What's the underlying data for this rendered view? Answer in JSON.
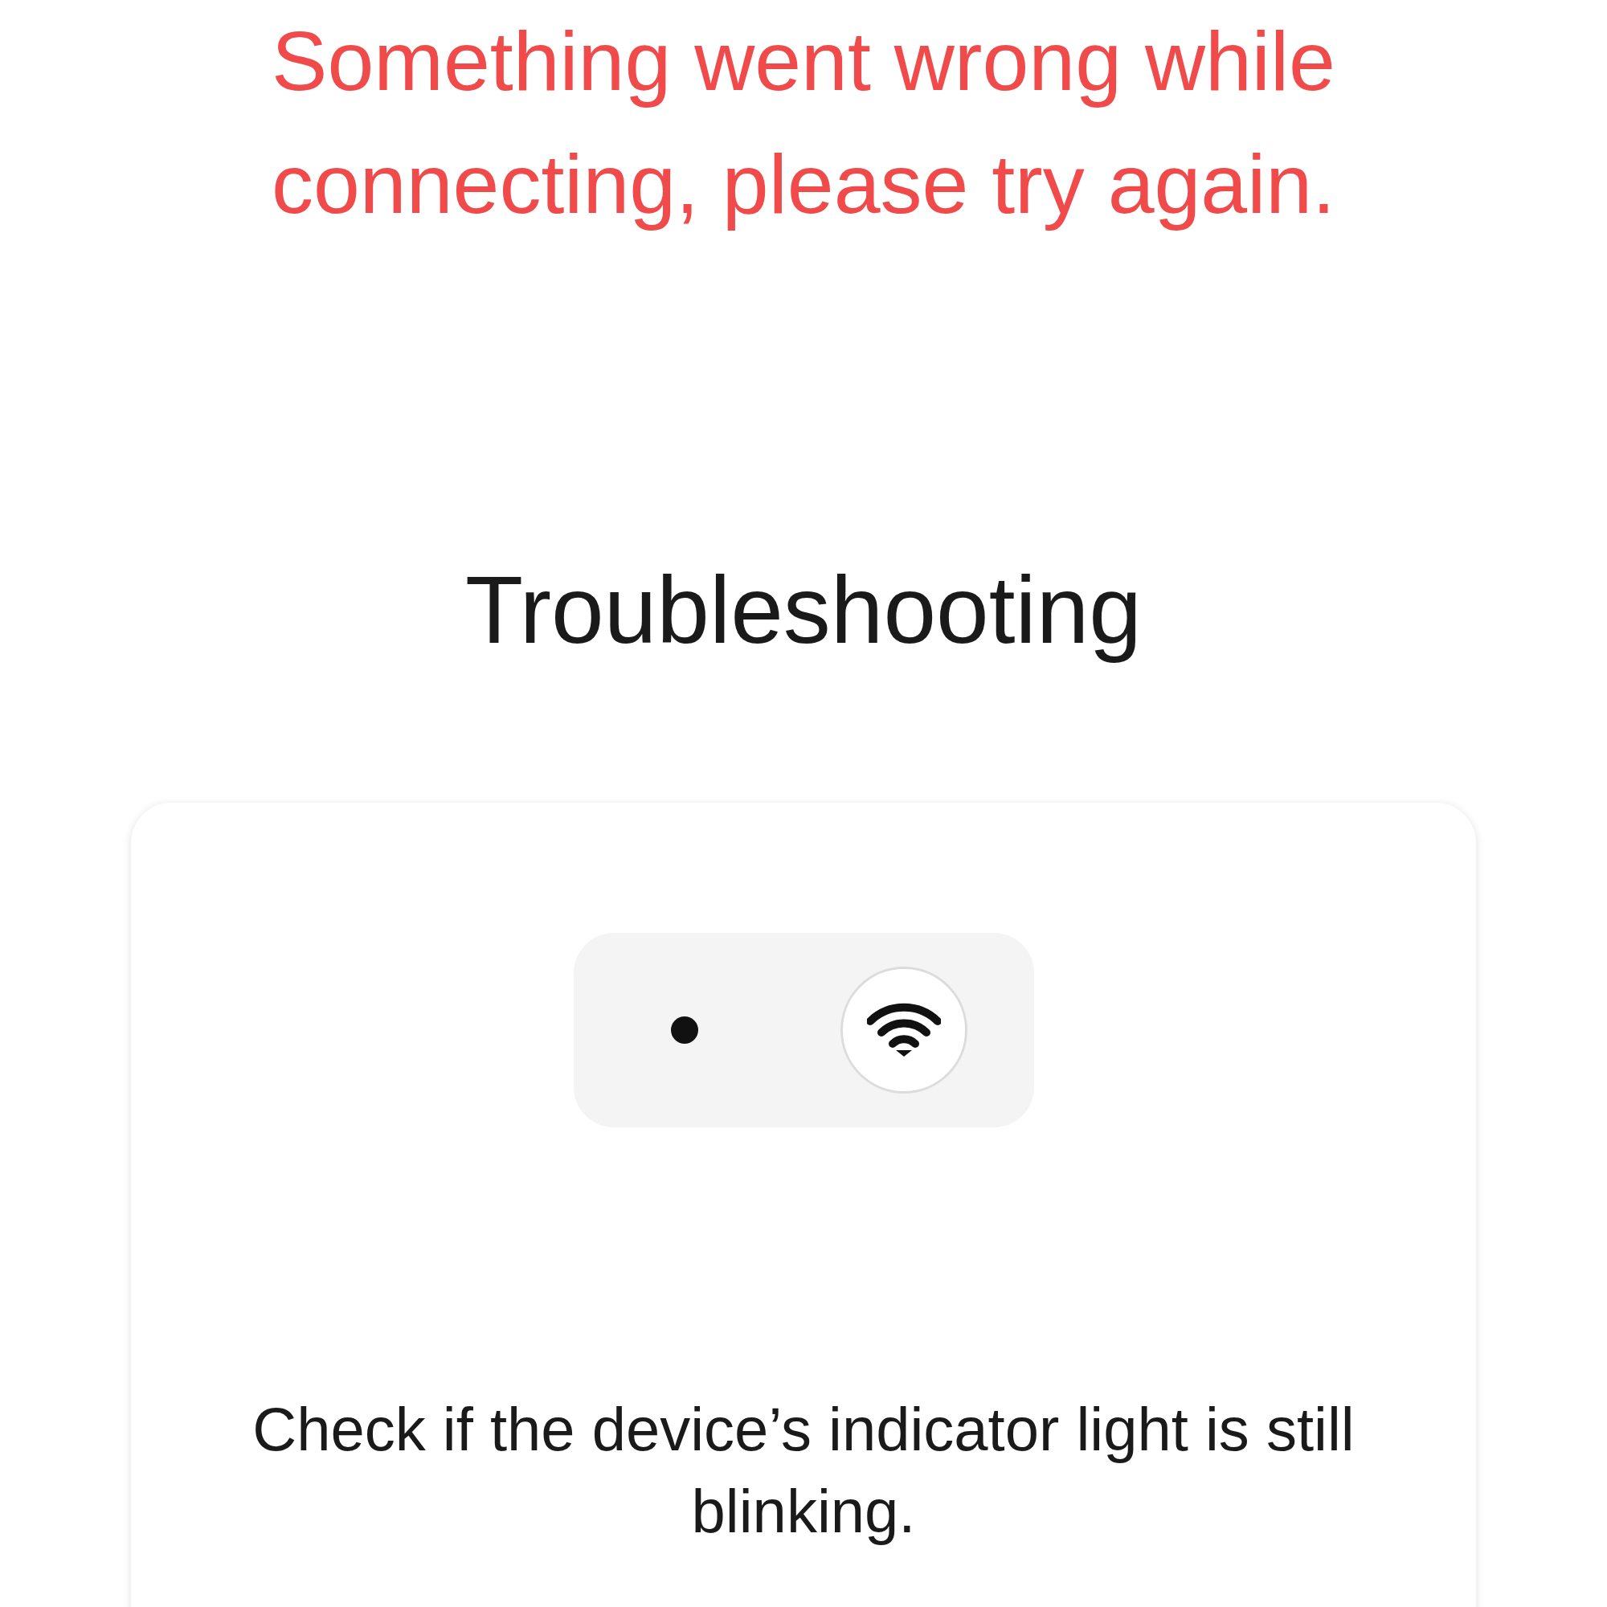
{
  "error_message": "Something went wrong while connecting, please try again.",
  "title": "Troubleshooting",
  "card": {
    "instruction": "Check if the device’s indicator light is still blinking."
  }
}
